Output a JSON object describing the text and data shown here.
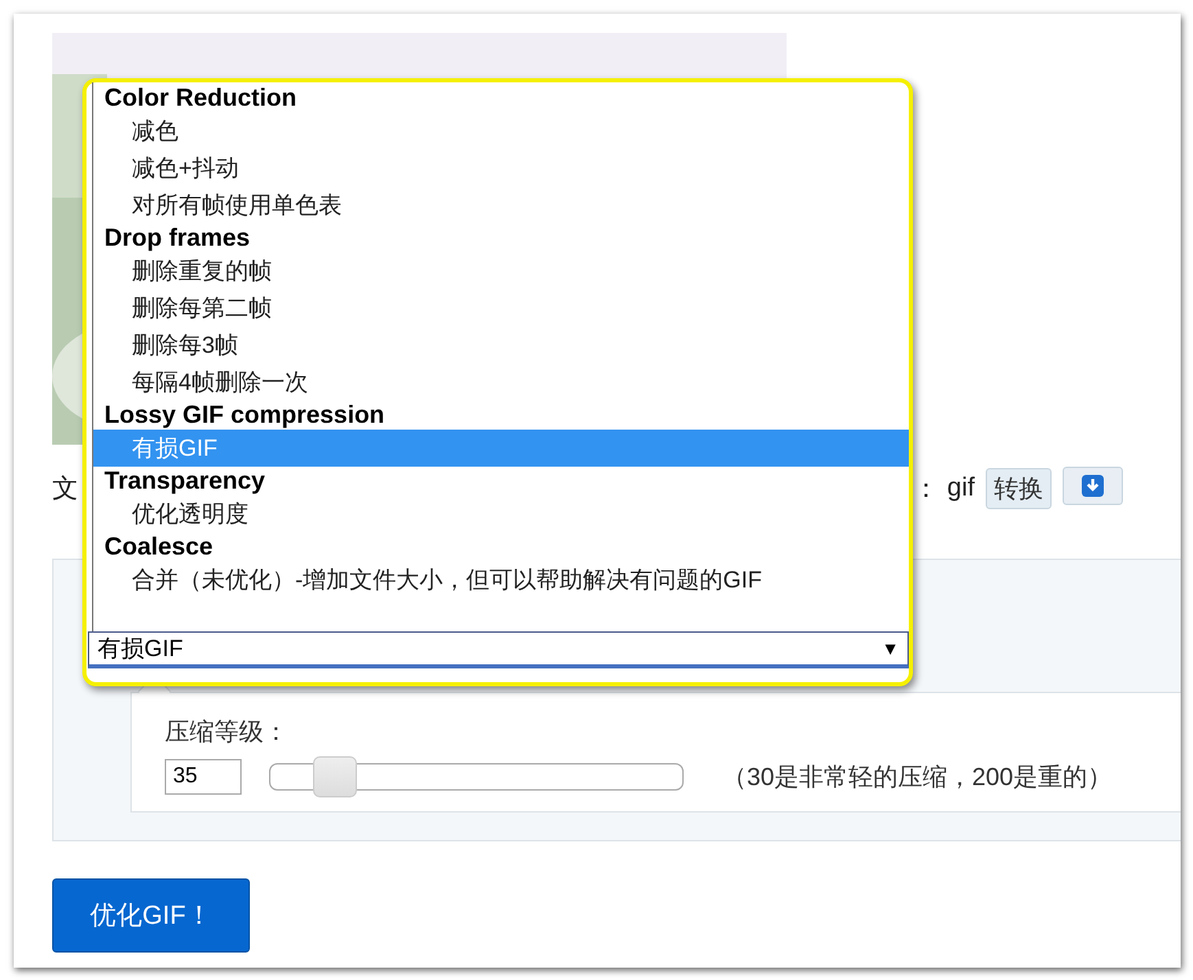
{
  "file_row": {
    "label_fragment": "文",
    "format_label": "：",
    "format": "gif",
    "convert_button": "转换"
  },
  "method_select": {
    "value": "有损GIF",
    "caret": "▼",
    "groups": [
      {
        "label": "Color Reduction",
        "options": [
          {
            "label": "减色",
            "selected": false
          },
          {
            "label": "减色+抖动",
            "selected": false
          },
          {
            "label": "对所有帧使用单色表",
            "selected": false
          }
        ]
      },
      {
        "label": "Drop frames",
        "options": [
          {
            "label": "删除重复的帧",
            "selected": false
          },
          {
            "label": "删除每第二帧",
            "selected": false
          },
          {
            "label": "删除每3帧",
            "selected": false
          },
          {
            "label": "每隔4帧删除一次",
            "selected": false
          }
        ]
      },
      {
        "label": "Lossy GIF compression",
        "options": [
          {
            "label": "有损GIF",
            "selected": true
          }
        ]
      },
      {
        "label": "Transparency",
        "options": [
          {
            "label": "优化透明度",
            "selected": false
          }
        ]
      },
      {
        "label": "Coalesce",
        "options": [
          {
            "label": "合并（未优化）-增加文件大小，但可以帮助解决有问题的GIF",
            "selected": false
          }
        ]
      }
    ]
  },
  "compression": {
    "label": "压缩等级：",
    "value": "35",
    "level": 0.16,
    "hint": "（30是非常轻的压缩，200是重的）"
  },
  "submit_button": "优化GIF！"
}
